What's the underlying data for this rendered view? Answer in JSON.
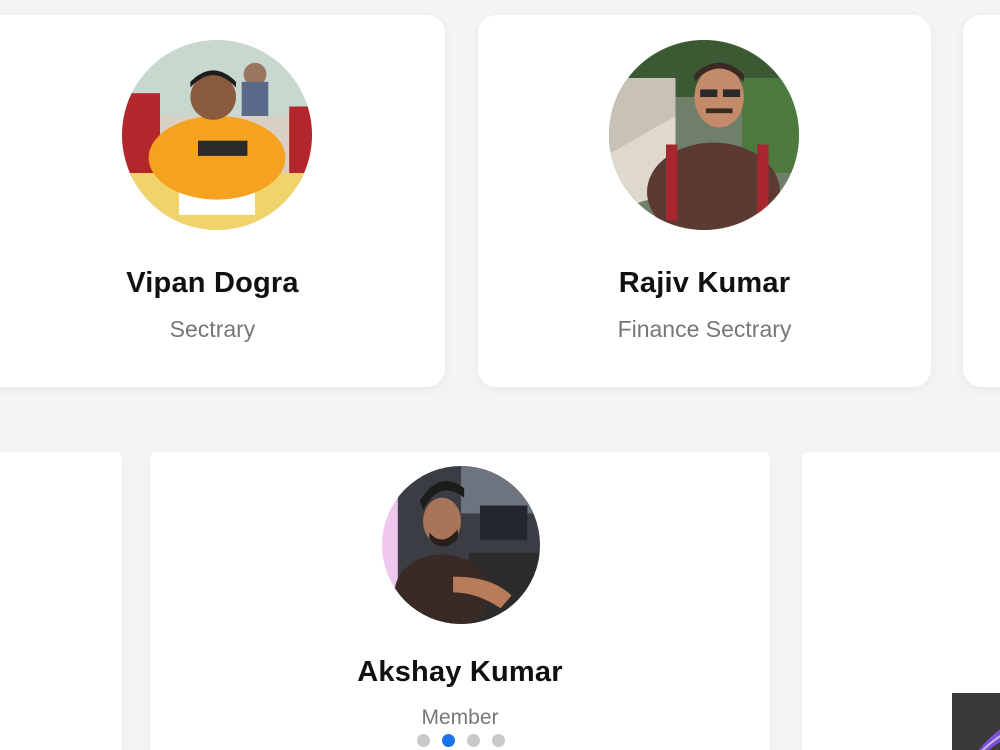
{
  "team_top": [
    {
      "name": "Vipan Dogra",
      "role": "Sectrary",
      "avatar_icon": "person-photo-icon"
    },
    {
      "name": "Rajiv Kumar",
      "role": "Finance Sectrary",
      "avatar_icon": "person-photo-icon"
    }
  ],
  "team_bottom": [
    {
      "name": "Akshay Kumar",
      "role": "Member",
      "avatar_icon": "person-photo-icon"
    }
  ],
  "carousel": {
    "slide_count": 4,
    "active_index": 1
  },
  "colors": {
    "page_background": "#f4f4f4",
    "card_background": "#ffffff",
    "name_text": "#111111",
    "role_text": "#777777",
    "active_dot": "#1a73e8",
    "inactive_dot": "#c9c9c9"
  }
}
